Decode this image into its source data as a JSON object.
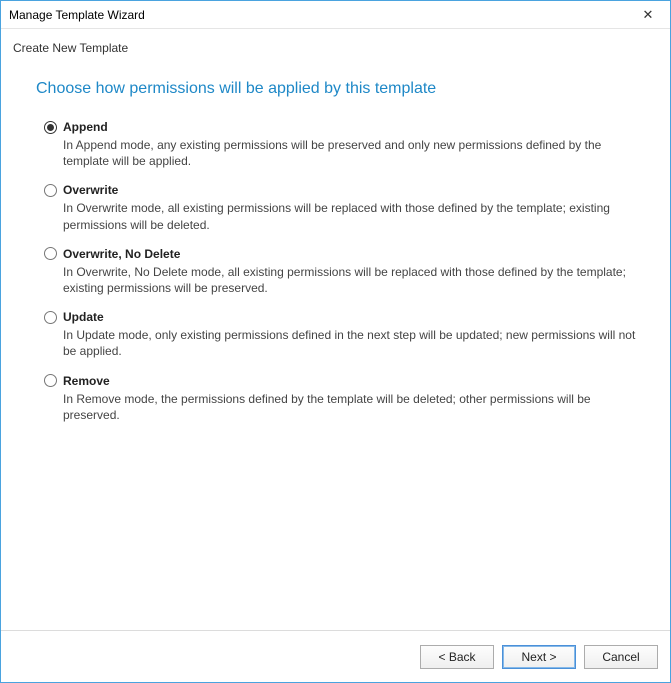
{
  "window": {
    "title": "Manage Template Wizard",
    "subtitle": "Create New Template"
  },
  "page": {
    "heading": "Choose how permissions will be applied by this template"
  },
  "options": {
    "append": {
      "label": "Append",
      "desc": "In Append mode, any existing permissions will be preserved and only new permissions defined by the template will be applied.",
      "selected": true
    },
    "overwrite": {
      "label": "Overwrite",
      "desc": "In Overwrite mode, all existing permissions will be replaced with those defined by the template; existing permissions will be deleted.",
      "selected": false
    },
    "overwrite_no_delete": {
      "label": "Overwrite, No Delete",
      "desc": "In Overwrite, No Delete mode, all existing permissions will be replaced with those defined by the template; existing permissions will be preserved.",
      "selected": false
    },
    "update": {
      "label": "Update",
      "desc": "In Update mode, only existing permissions defined in the next step will be updated; new permissions will not be applied.",
      "selected": false
    },
    "remove": {
      "label": "Remove",
      "desc": "In Remove mode, the permissions defined by the template will be deleted; other permissions will be preserved.",
      "selected": false
    }
  },
  "footer": {
    "back": "< Back",
    "next": "Next >",
    "cancel": "Cancel"
  }
}
